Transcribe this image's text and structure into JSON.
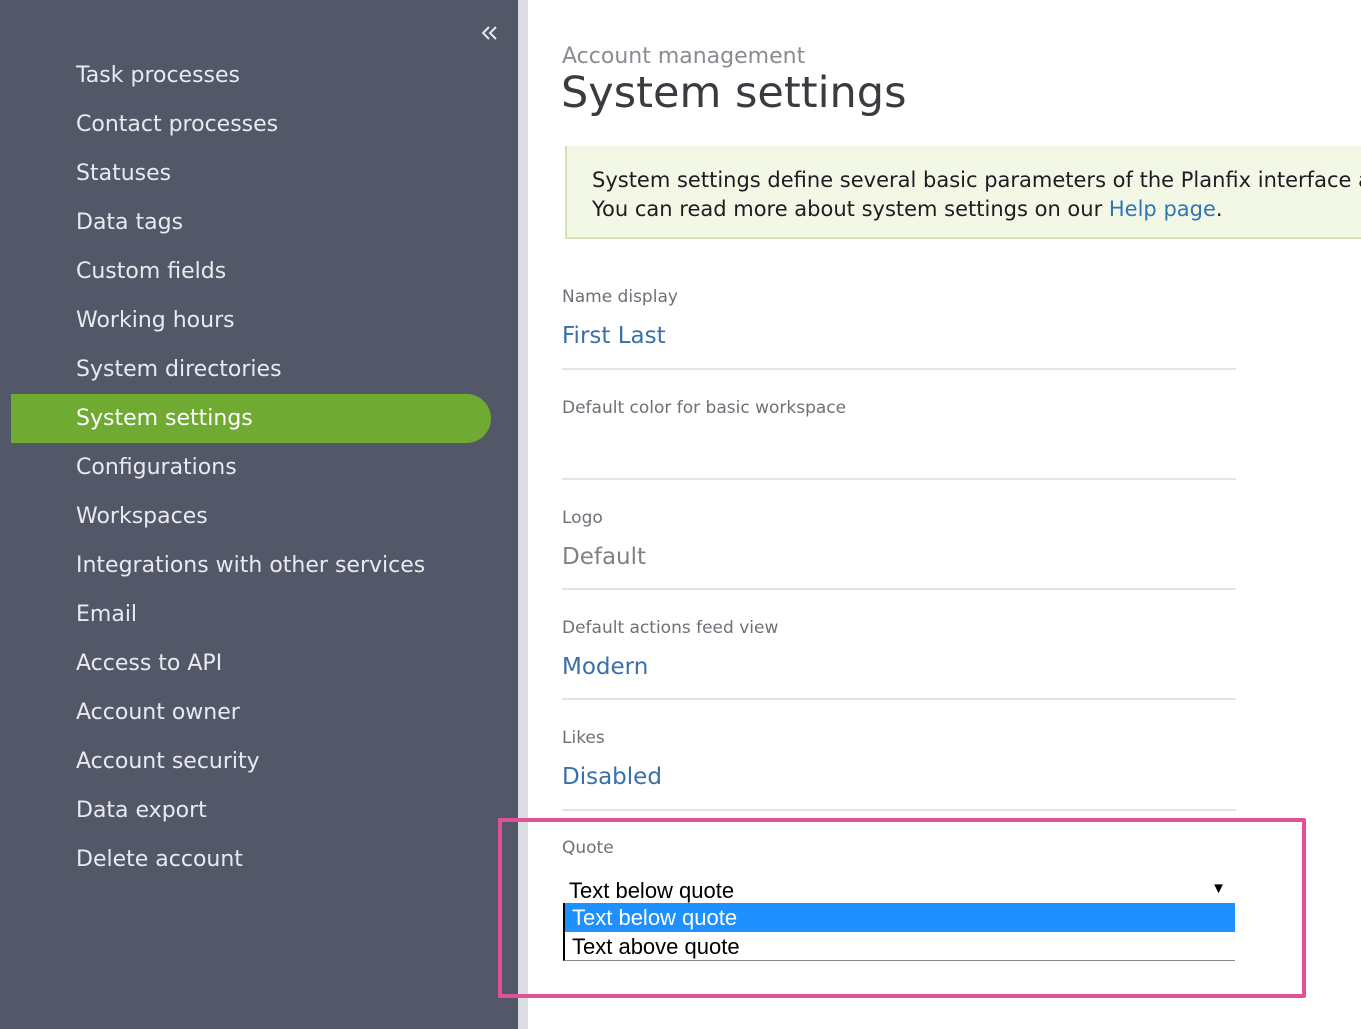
{
  "sidebar": {
    "items": [
      {
        "label": "Task processes"
      },
      {
        "label": "Contact processes"
      },
      {
        "label": "Statuses"
      },
      {
        "label": "Data tags"
      },
      {
        "label": "Custom fields"
      },
      {
        "label": "Working hours"
      },
      {
        "label": "System directories"
      },
      {
        "label": "System settings",
        "active": true
      },
      {
        "label": "Configurations"
      },
      {
        "label": "Workspaces"
      },
      {
        "label": "Integrations with other services"
      },
      {
        "label": "Email"
      },
      {
        "label": "Access to API"
      },
      {
        "label": "Account owner"
      },
      {
        "label": "Account security"
      },
      {
        "label": "Data export"
      },
      {
        "label": "Delete account"
      }
    ],
    "collapse_icon": "double-chevron-left-icon"
  },
  "header": {
    "breadcrumb": "Account management",
    "title": "System settings"
  },
  "info": {
    "line1": "System settings define several basic parameters of the Planfix interface and",
    "line2_prefix": "You can read more about system settings on our ",
    "line2_link": "Help page",
    "line2_suffix": "."
  },
  "settings": {
    "name_display": {
      "label": "Name display",
      "value": "First Last"
    },
    "default_color": {
      "label": "Default color for basic workspace",
      "value": ""
    },
    "logo": {
      "label": "Logo",
      "value": "Default"
    },
    "actions_feed": {
      "label": "Default actions feed view",
      "value": "Modern"
    },
    "likes": {
      "label": "Likes",
      "value": "Disabled"
    },
    "quote": {
      "label": "Quote",
      "selected": "Text below quote",
      "options": [
        "Text below quote",
        "Text above quote"
      ]
    }
  },
  "colors": {
    "sidebar_bg": "#535868",
    "active_item": "#6fab33",
    "link": "#3a6fa8",
    "highlight_border": "#e0519a",
    "option_selected": "#1e90ff"
  }
}
